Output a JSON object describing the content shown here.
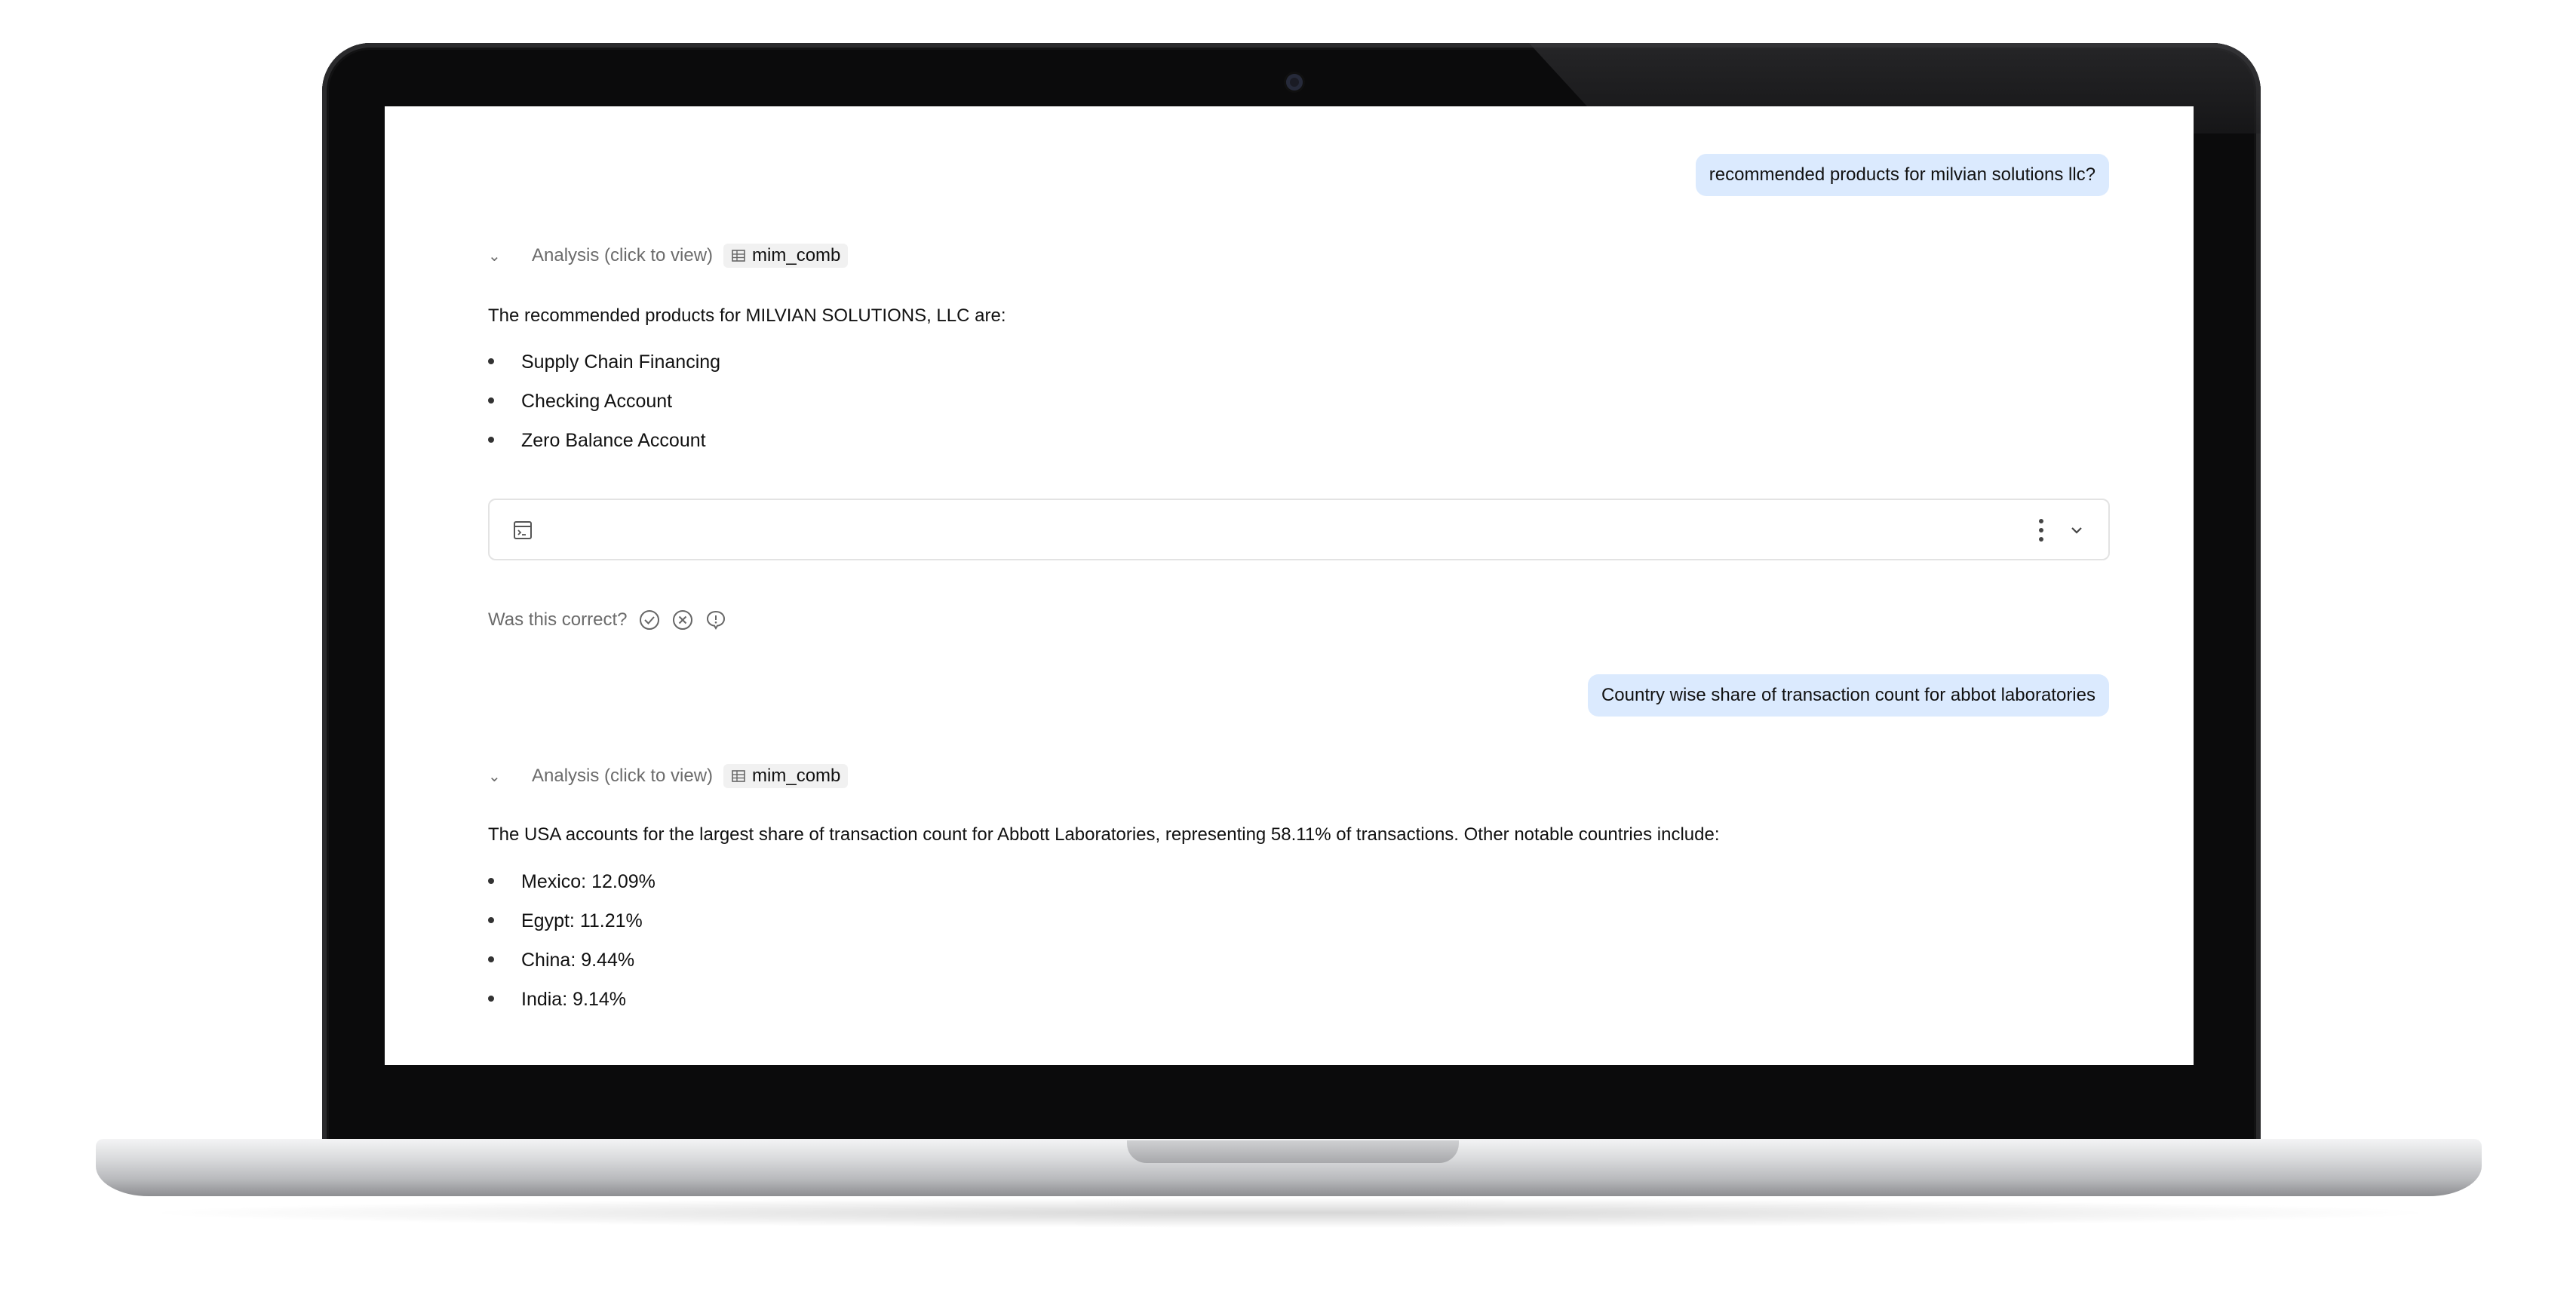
{
  "conversation": [
    {
      "user_message": "recommended products for milvian solutions llc?",
      "analysis_label": "Analysis (click to view)",
      "tool_name": "mim_comb",
      "answer_intro": "The recommended products for MILVIAN SOLUTIONS, LLC are:",
      "bullets": [
        "Supply Chain Financing",
        "Checking Account",
        "Zero Balance Account"
      ],
      "feedback_prompt": "Was this correct?"
    },
    {
      "user_message": "Country wise share of transaction count for abbot laboratories",
      "analysis_label": "Analysis (click to view)",
      "tool_name": "mim_comb",
      "answer_intro": "The USA accounts for the largest share of transaction count for Abbott Laboratories, representing 58.11% of transactions. Other notable countries include:",
      "bullets": [
        "Mexico: 12.09%",
        "Egypt: 11.21%",
        "China: 9.44%",
        "India: 9.14%"
      ]
    }
  ],
  "icons": {
    "collapse": "chevron-down-icon",
    "tool": "table-icon",
    "result": "terminal-table-icon",
    "menu": "more-vertical-icon",
    "thumbs_correct": "check-circle-icon",
    "thumbs_incorrect": "x-circle-icon",
    "comment": "comment-icon"
  },
  "colors": {
    "user_bubble": "#dbeafe",
    "muted_text": "#6b6b6b",
    "card_border": "#e3e3e3"
  }
}
